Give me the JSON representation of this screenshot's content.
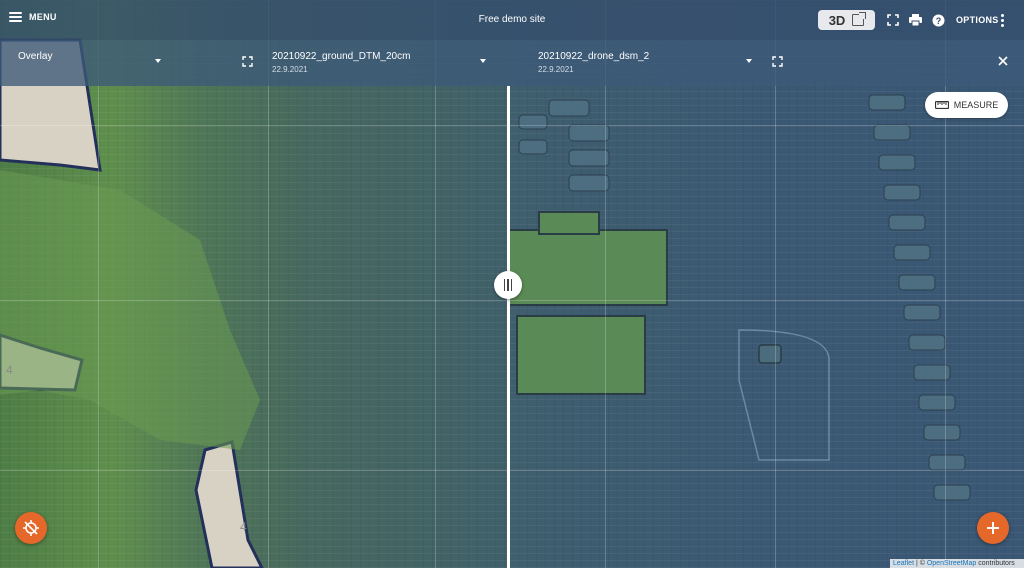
{
  "header": {
    "menu_label": "MENU",
    "site_title": "Free demo site",
    "btn_3d_label": "3D",
    "options_label": "OPTIONS"
  },
  "layers": {
    "overlay": {
      "label": "Overlay"
    },
    "left": {
      "name": "20210922_ground_DTM_20cm",
      "date": "22.9.2021"
    },
    "right": {
      "name": "20210922_drone_dsm_2",
      "date": "22.9.2021"
    }
  },
  "tools": {
    "measure_label": "MEASURE"
  },
  "map": {
    "area_labels": [
      "4",
      "4"
    ]
  },
  "attribution": {
    "leaflet": "Leaflet",
    "separator": " | © ",
    "osm": "OpenStreetMap",
    "suffix": " contributors"
  },
  "colors": {
    "accent_orange": "#e5672a",
    "header_blue": "#344e6c",
    "terrain_green": "#5f8f4d",
    "terrain_blue": "#3b5973"
  },
  "icons": {
    "menu": "hamburger-icon",
    "external": "external-link-icon",
    "fullscreen": "fullscreen-icon",
    "print": "print-icon",
    "help": "help-icon",
    "more": "vertical-dots-icon",
    "close": "close-icon",
    "ruler": "ruler-icon",
    "locate": "locate-off-icon",
    "add": "plus-icon"
  }
}
